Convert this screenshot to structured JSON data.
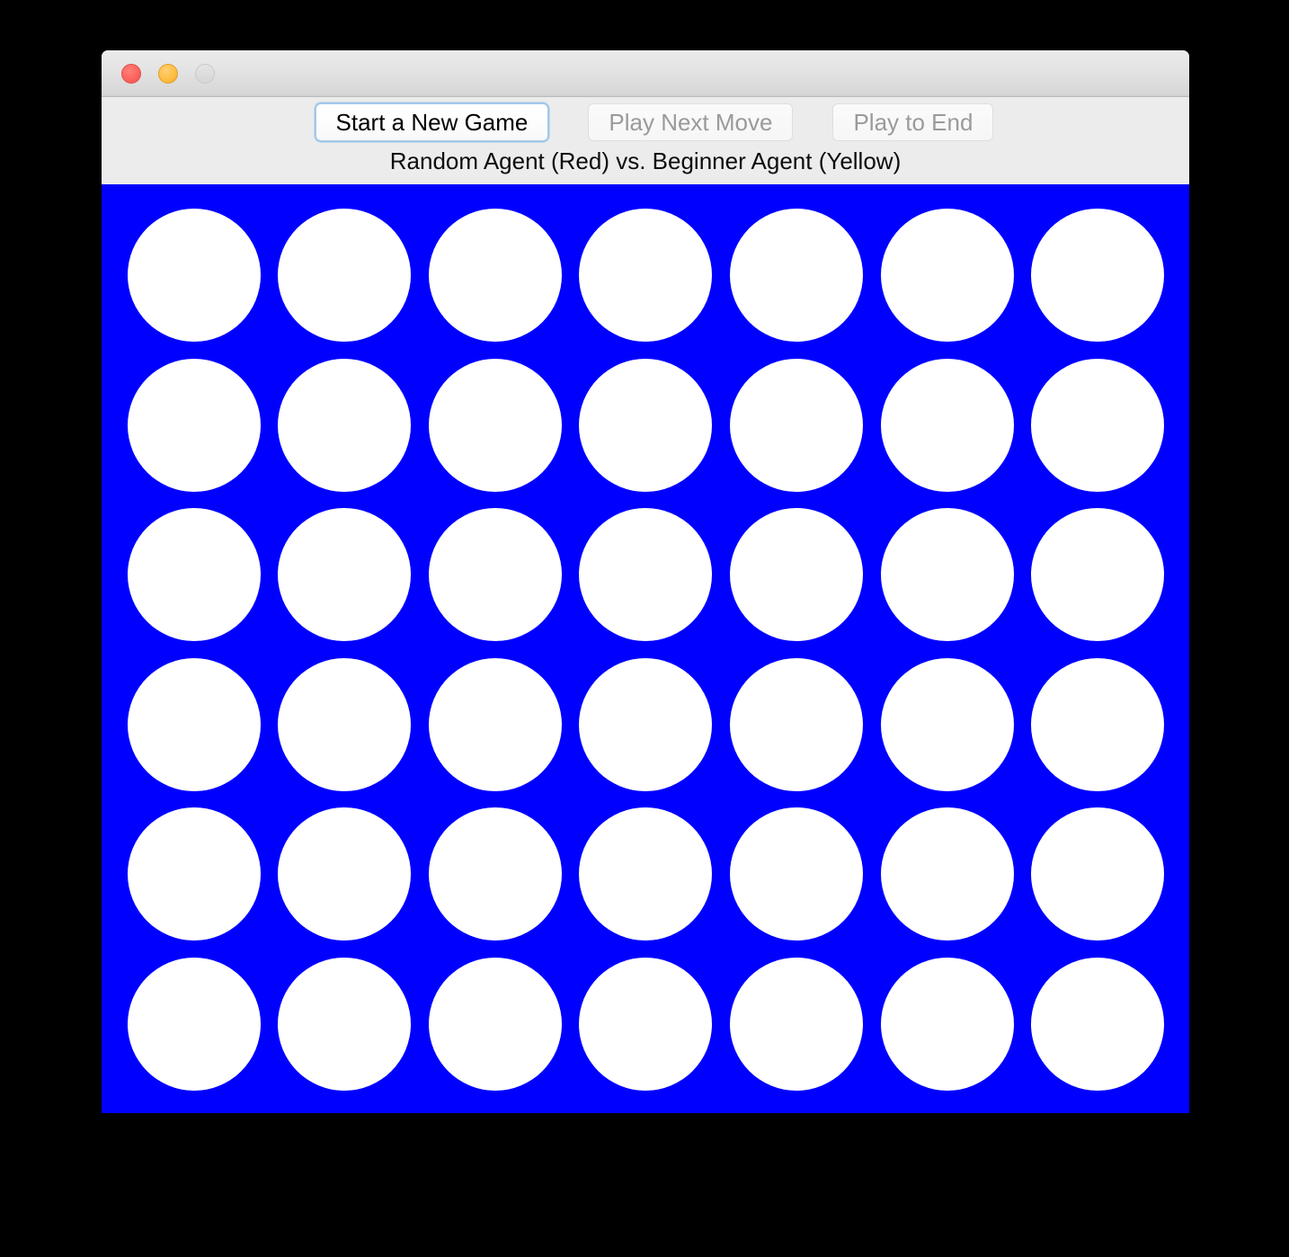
{
  "window": {
    "traffic_lights": [
      {
        "name": "close",
        "color": "#fc625d"
      },
      {
        "name": "minimize",
        "color": "#fdbc40"
      },
      {
        "name": "zoom",
        "color": "#dcdcdc"
      }
    ]
  },
  "toolbar": {
    "buttons": [
      {
        "label": "Start a New Game",
        "state": "default"
      },
      {
        "label": "Play Next Move",
        "state": "disabled"
      },
      {
        "label": "Play to End",
        "state": "disabled"
      }
    ],
    "status_label": "Random Agent (Red) vs. Beginner Agent (Yellow)"
  },
  "board": {
    "background_color": "#0000ff",
    "empty_color": "#ffffff",
    "red_color": "#ff0000",
    "yellow_color": "#ffff00",
    "columns": 7,
    "rows": 6,
    "cells": [
      [
        "empty",
        "empty",
        "empty",
        "empty",
        "empty",
        "empty",
        "empty"
      ],
      [
        "empty",
        "empty",
        "empty",
        "empty",
        "empty",
        "empty",
        "empty"
      ],
      [
        "empty",
        "empty",
        "empty",
        "empty",
        "empty",
        "empty",
        "empty"
      ],
      [
        "empty",
        "empty",
        "empty",
        "empty",
        "empty",
        "empty",
        "empty"
      ],
      [
        "empty",
        "empty",
        "empty",
        "empty",
        "empty",
        "empty",
        "empty"
      ],
      [
        "empty",
        "empty",
        "empty",
        "empty",
        "empty",
        "empty",
        "empty"
      ]
    ]
  }
}
